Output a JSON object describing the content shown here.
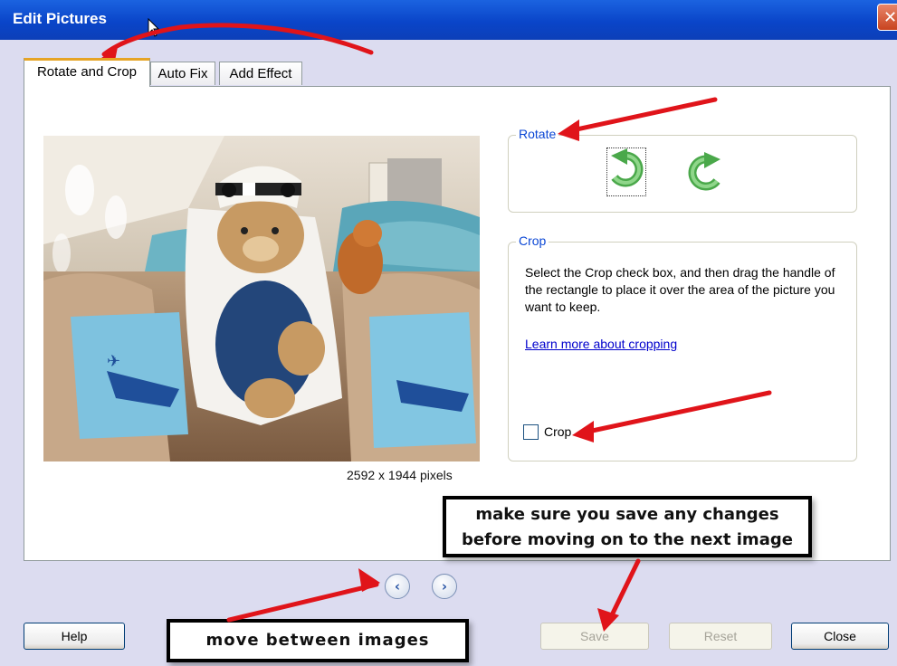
{
  "window": {
    "title": "Edit Pictures",
    "close_glyph": "✕"
  },
  "tabs": [
    {
      "label": "Rotate and Crop",
      "active": true
    },
    {
      "label": "Auto Fix",
      "active": false
    },
    {
      "label": "Add Effect",
      "active": false
    }
  ],
  "preview": {
    "image_icon": "teddy-bear-photo",
    "dimensions": "2592 x 1944 pixels"
  },
  "rotate": {
    "legend": "Rotate",
    "left_icon": "rotate-left-icon",
    "right_icon": "rotate-right-icon"
  },
  "crop": {
    "legend": "Crop",
    "instructions": "Select the Crop check box, and then drag the handle of the rectangle to place it over the area of the picture you want to keep.",
    "link": "Learn more about cropping",
    "checkbox_label": "Crop",
    "checked": false
  },
  "navigation": {
    "prev_glyph": "‹",
    "next_glyph": "›"
  },
  "buttons": {
    "help": "Help",
    "save": "Save",
    "reset": "Reset",
    "close": "Close"
  },
  "annotations": {
    "save_note_line1": "make sure you save any changes",
    "save_note_line2": "before moving on to the next image",
    "move_note": "move between images",
    "arrow_color": "#e0141a"
  },
  "colors": {
    "titlebar": "#0a45c9",
    "dialog_bg": "#dcdcf0",
    "tab_accent": "#e6a425",
    "link": "#0000cc"
  }
}
